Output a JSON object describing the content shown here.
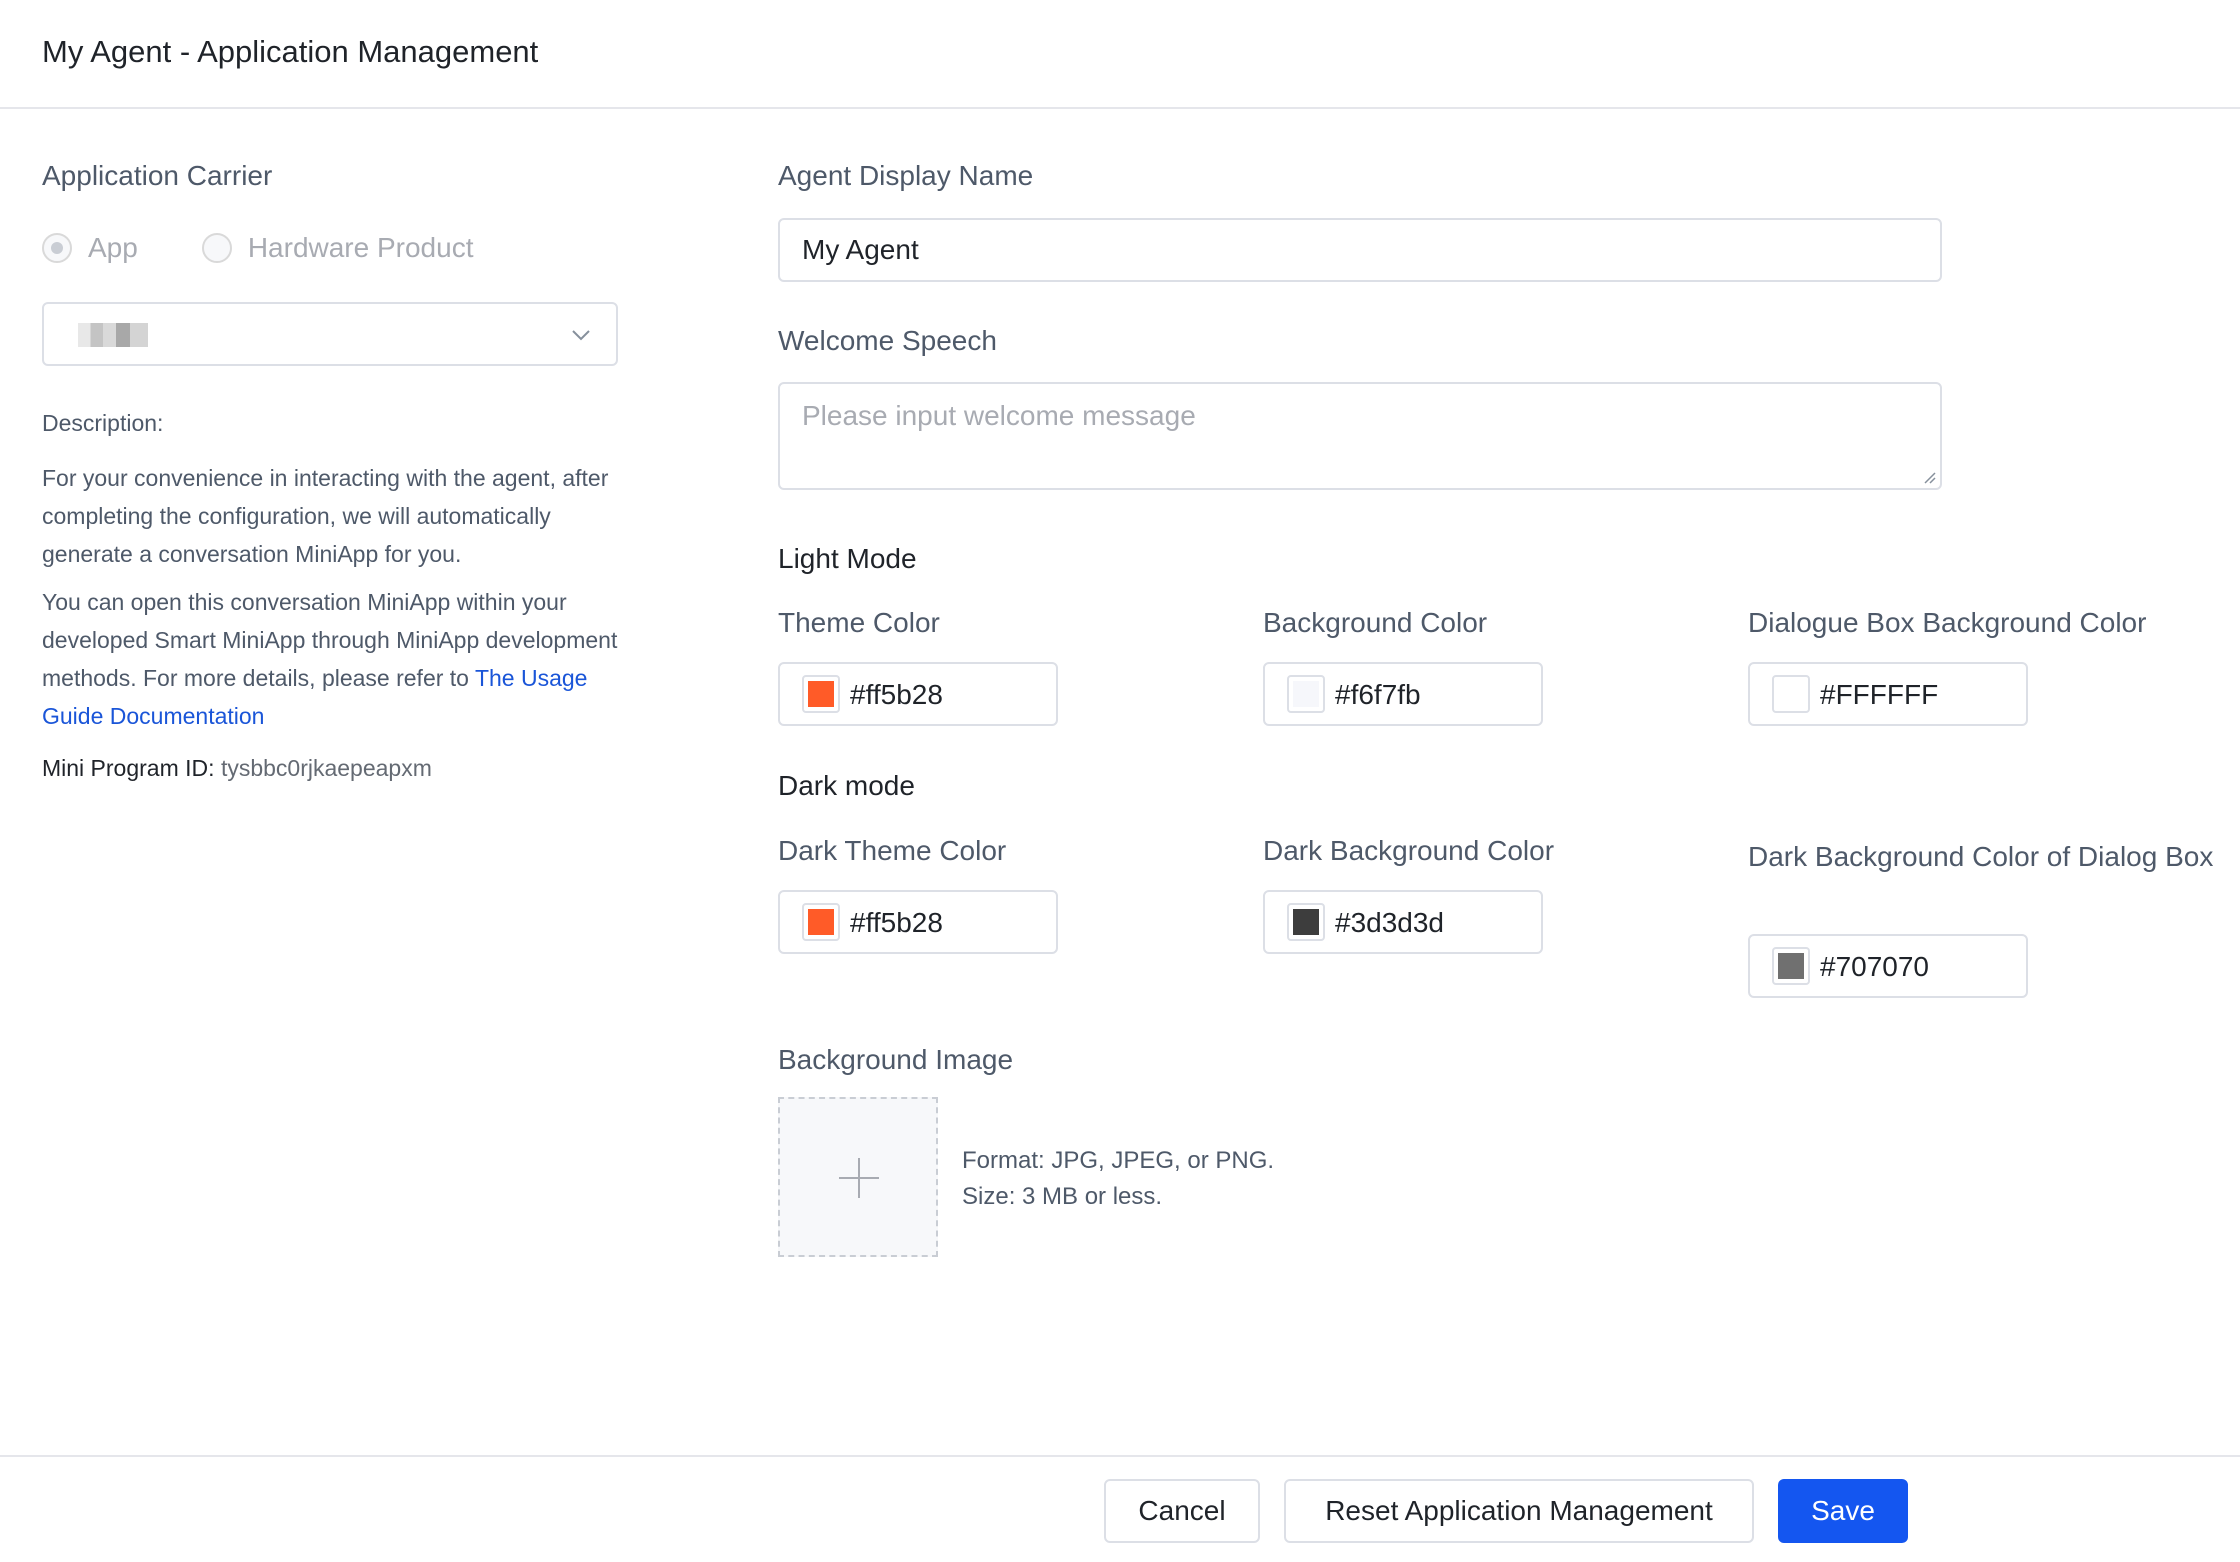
{
  "header": {
    "title": "My Agent - Application Management"
  },
  "carrier": {
    "label": "Application Carrier",
    "options": [
      {
        "label": "App",
        "checked": true
      },
      {
        "label": "Hardware Product",
        "checked": false
      }
    ],
    "select_value": ""
  },
  "description": {
    "label": "Description:",
    "p1": "For your convenience in interacting with the agent, after completing the configuration, we will automatically generate a conversation MiniApp for you.",
    "p2_prefix": "You can open this conversation MiniApp within your developed Smart MiniApp through MiniApp development methods. For more details, please refer to ",
    "p2_link": "The Usage Guide Documentation",
    "mini_id_label": "Mini Program ID:",
    "mini_id_value": "tysbbc0rjkaepeapxm"
  },
  "form": {
    "display_name_label": "Agent Display Name",
    "display_name_value": "My Agent",
    "welcome_label": "Welcome Speech",
    "welcome_placeholder": "Please input welcome message",
    "light_mode_label": "Light Mode",
    "light": [
      {
        "label": "Theme Color",
        "value": "#ff5b28",
        "color": "#ff5b28"
      },
      {
        "label": "Background Color",
        "value": "#f6f7fb",
        "color": "#f6f7fb"
      },
      {
        "label": "Dialogue Box Background Color",
        "value": "#FFFFFF",
        "color": "#FFFFFF"
      }
    ],
    "dark_mode_label": "Dark mode",
    "dark": [
      {
        "label": "Dark Theme Color",
        "value": "#ff5b28",
        "color": "#ff5b28"
      },
      {
        "label": "Dark Background Color",
        "value": "#3d3d3d",
        "color": "#3d3d3d"
      },
      {
        "label": "Dark Background Color of Dialog Box",
        "value": "#707070",
        "color": "#707070"
      }
    ],
    "bg_image_label": "Background Image",
    "upload_format": "Format: JPG, JPEG, or PNG.",
    "upload_size": "Size: 3 MB or less."
  },
  "footer": {
    "cancel": "Cancel",
    "reset": "Reset Application Management",
    "save": "Save"
  },
  "colors": {
    "primary": "#1456f0",
    "link": "#1a55d8"
  }
}
